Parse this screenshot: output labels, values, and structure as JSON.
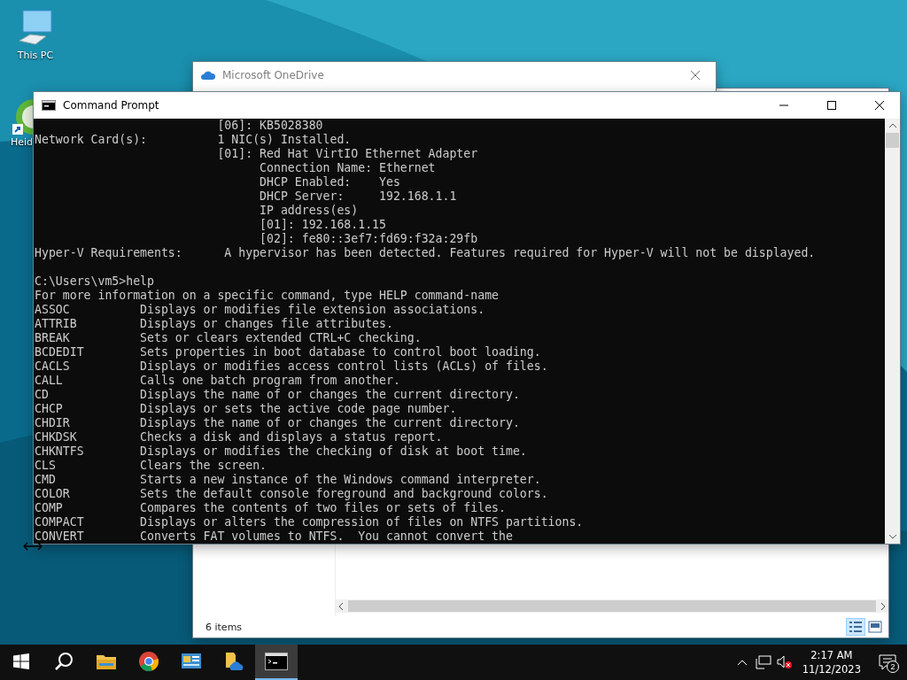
{
  "desktop_icons": [
    {
      "label": "This PC",
      "kind": "pc"
    },
    {
      "label": "Heid",
      "kind": "app"
    }
  ],
  "explorer": {
    "status": "6 items",
    "views": [
      {
        "kind": "details",
        "selected": true
      },
      {
        "kind": "tiles",
        "selected": false
      }
    ]
  },
  "onedrive": {
    "title": "Microsoft OneDrive"
  },
  "console": {
    "title": "Command Prompt",
    "lines": [
      "                          [06]: KB5028380",
      "Network Card(s):          1 NIC(s) Installed.",
      "                          [01]: Red Hat VirtIO Ethernet Adapter",
      "                                Connection Name: Ethernet",
      "                                DHCP Enabled:    Yes",
      "                                DHCP Server:     192.168.1.1",
      "                                IP address(es)",
      "                                [01]: 192.168.1.15",
      "                                [02]: fe80::3ef7:fd69:f32a:29fb",
      "Hyper-V Requirements:      A hypervisor has been detected. Features required for Hyper-V will not be displayed."
    ],
    "help_lines": [
      "C:\\Users\\vm5>help",
      "For more information on a specific command, type HELP command-name",
      "ASSOC          Displays or modifies file extension associations.",
      "ATTRIB         Displays or changes file attributes.",
      "BREAK          Sets or clears extended CTRL+C checking.",
      "BCDEDIT        Sets properties in boot database to control boot loading.",
      "CACLS          Displays or modifies access control lists (ACLs) of files.",
      "CALL           Calls one batch program from another.",
      "CD             Displays the name of or changes the current directory.",
      "CHCP           Displays or sets the active code page number.",
      "CHDIR          Displays the name of or changes the current directory.",
      "CHKDSK         Checks a disk and displays a status report.",
      "CHKNTFS        Displays or modifies the checking of disk at boot time.",
      "CLS            Clears the screen.",
      "CMD            Starts a new instance of the Windows command interpreter.",
      "COLOR          Sets the default console foreground and background colors.",
      "COMP           Compares the contents of two files or sets of files.",
      "COMPACT        Displays or alters the compression of files on NTFS partitions.",
      "CONVERT        Converts FAT volumes to NTFS.  You cannot convert the"
    ]
  },
  "taskbar": {
    "apps": [
      {
        "kind": "folder",
        "selected": false
      },
      {
        "kind": "chrome",
        "selected": false
      },
      {
        "kind": "panel",
        "selected": false
      },
      {
        "kind": "cloudfile",
        "selected": false
      },
      {
        "kind": "console",
        "selected": true
      }
    ],
    "time": "2:17 AM",
    "date": "11/12/2023",
    "notifications": "2"
  }
}
